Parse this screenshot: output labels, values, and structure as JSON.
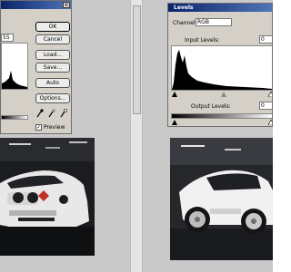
{
  "left_dialog": {
    "field_value": "55",
    "buttons": {
      "ok": "OK",
      "cancel": "Cancel",
      "load": "Load...",
      "save": "Save...",
      "auto": "Auto",
      "options": "Options..."
    },
    "preview_label": "Preview",
    "preview_checked": true,
    "eyedropper_icons": [
      "black-point-eyedropper-icon",
      "gray-point-eyedropper-icon",
      "white-point-eyedropper-icon"
    ]
  },
  "right_dialog": {
    "title": "Levels",
    "channel_label": "Channel:",
    "channel_value": "RGB",
    "input_levels_label": "Input Levels:",
    "input_levels_value": "0",
    "output_levels_label": "Output Levels:",
    "output_levels_value": "0"
  },
  "colors": {
    "dialog_bg": "#d4d0c8",
    "titlebar": "#0a246a",
    "workspace": "#c9c9c9"
  }
}
